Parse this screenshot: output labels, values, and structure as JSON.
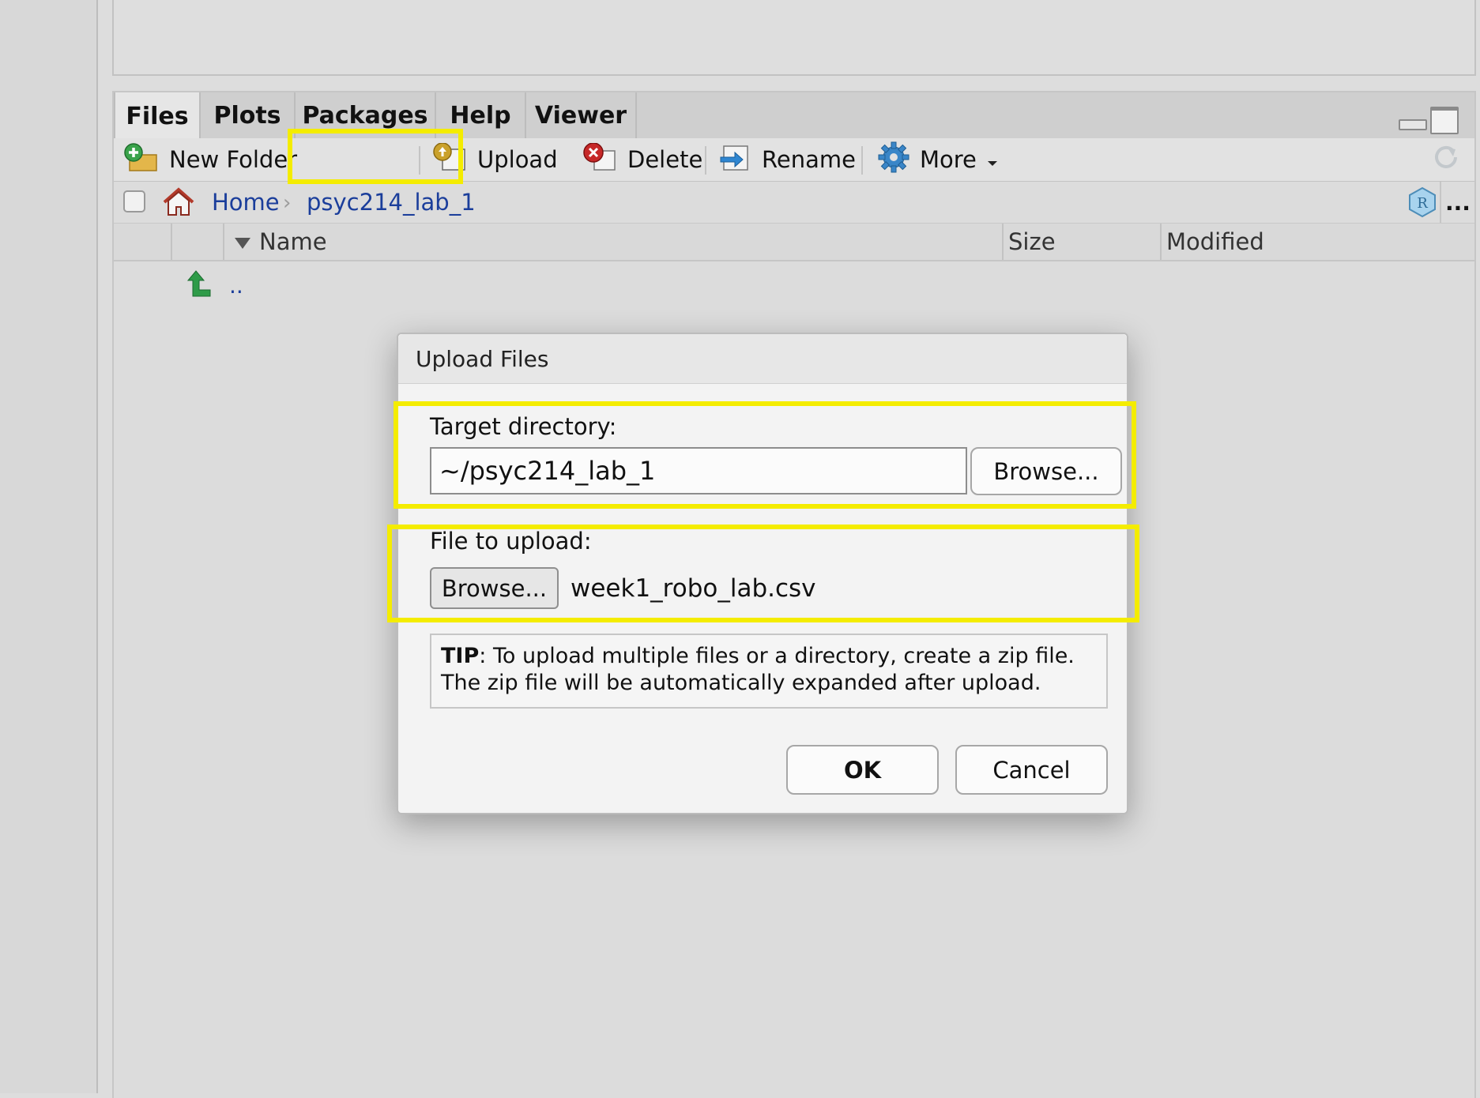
{
  "tabs": [
    "Files",
    "Plots",
    "Packages",
    "Help",
    "Viewer"
  ],
  "toolbar": {
    "new_folder": "New Folder",
    "upload": "Upload",
    "delete": "Delete",
    "rename": "Rename",
    "more": "More"
  },
  "path": {
    "home": "Home",
    "current": "psyc214_lab_1",
    "overflow": "..."
  },
  "columns": {
    "name": "Name",
    "size": "Size",
    "modified": "Modified"
  },
  "parent_dir_label": "..",
  "dialog": {
    "title": "Upload Files",
    "target_label": "Target directory:",
    "target_value": "~/psyc214_lab_1",
    "browse_dir": "Browse...",
    "file_label": "File to upload:",
    "browse_file": "Browse...",
    "file_name": "week1_robo_lab.csv",
    "tip_bold": "TIP",
    "tip_text": ": To upload multiple files or a directory, create a zip file. The zip file will be automatically expanded after upload.",
    "ok": "OK",
    "cancel": "Cancel"
  },
  "colors": {
    "highlight": "#f4ec00",
    "link": "#1b3e9b"
  },
  "icons": [
    "new-folder-icon",
    "upload-icon",
    "delete-icon",
    "rename-icon",
    "gear-icon",
    "home-icon",
    "up-arrow-icon",
    "r-project-icon",
    "refresh-icon"
  ]
}
